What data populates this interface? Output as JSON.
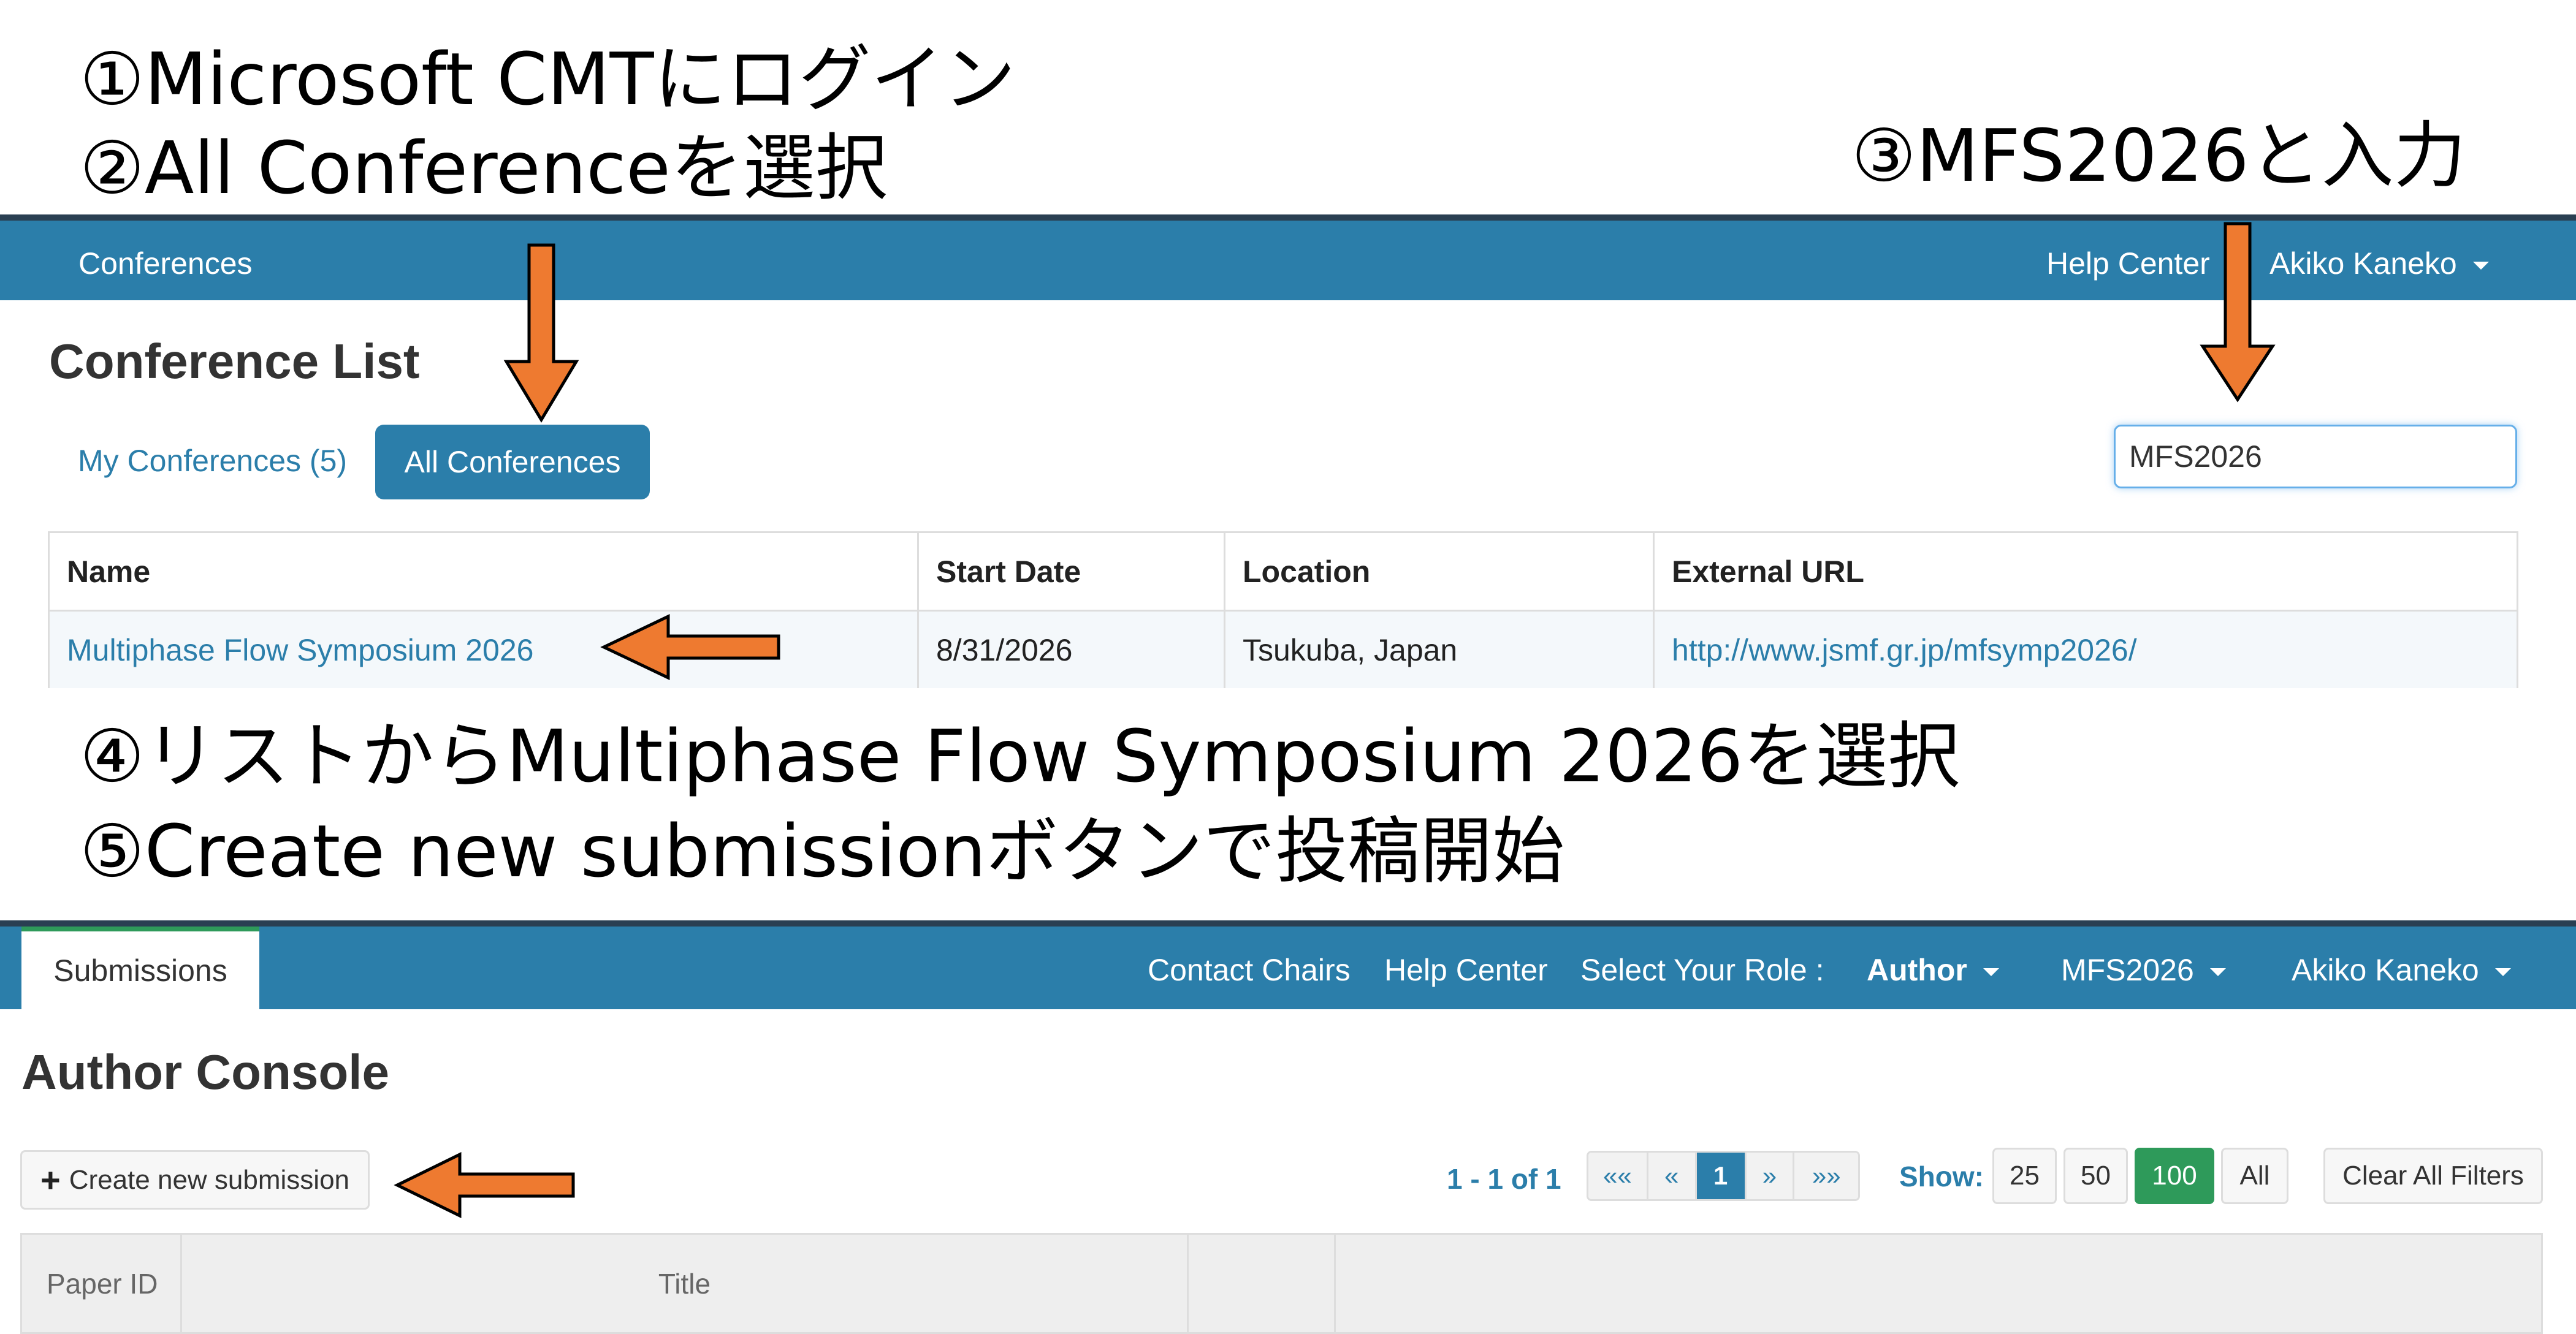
{
  "annotations": {
    "step1": "①Microsoft CMTにログイン",
    "step2": "②All Conferenceを選択",
    "step3": "③MFS2026と入力",
    "step4": "④リストからMultiphase Flow Symposium 2026を選択",
    "step5": "⑤Create new submissionボタンで投稿開始"
  },
  "top_nav": {
    "conferences": "Conferences",
    "help_center": "Help Center",
    "user": "Akiko Kaneko"
  },
  "conference_list": {
    "title": "Conference List",
    "tab_my": "My Conferences (5)",
    "tab_all": "All Conferences",
    "search_value": "MFS2026",
    "columns": [
      "Name",
      "Start Date",
      "Location",
      "External URL"
    ],
    "rows": [
      {
        "name": "Multiphase Flow Symposium 2026",
        "start_date": "8/31/2026",
        "location": "Tsukuba, Japan",
        "url": "http://www.jsmf.gr.jp/mfsymp2026/"
      }
    ]
  },
  "author_nav": {
    "submissions_tab": "Submissions",
    "contact_chairs": "Contact Chairs",
    "help_center": "Help Center",
    "select_role_label": "Select Your Role :",
    "role": "Author",
    "conference": "MFS2026",
    "user": "Akiko Kaneko"
  },
  "author_console": {
    "title": "Author Console",
    "create_button": "Create new submission",
    "create_icon": "plus-icon",
    "pagination_summary": "1 - 1 of 1",
    "pager": [
      "««",
      "«",
      "1",
      "»",
      "»»"
    ],
    "pager_active": "1",
    "show_label": "Show:",
    "show_options": [
      "25",
      "50",
      "100",
      "All"
    ],
    "show_selected": "100",
    "clear_filters": "Clear All Filters",
    "columns": [
      "Paper ID",
      "Title"
    ]
  },
  "colors": {
    "navbar": "#2b7eaa",
    "navbar_border": "#2a3f52",
    "arrow": "#ee7a30",
    "success": "#2e9a5a"
  }
}
